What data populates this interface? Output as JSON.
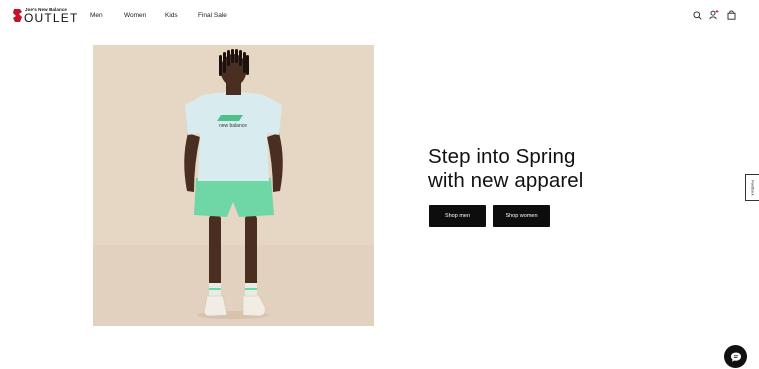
{
  "brand": {
    "top_line": "Joe's New Balance",
    "main_word": "OUTLET"
  },
  "nav": {
    "items": [
      {
        "label": "Men"
      },
      {
        "label": "Women"
      },
      {
        "label": "Kids"
      },
      {
        "label": "Final Sale"
      }
    ]
  },
  "header_icons": [
    "search-icon",
    "account-icon",
    "cart-icon"
  ],
  "hero": {
    "title_line1": "Step into Spring",
    "title_line2": "with new apparel",
    "shirt_text": "new balance",
    "buttons": {
      "shop_men": "Shop men",
      "shop_women": "Shop women"
    }
  },
  "side_tab": {
    "label": "Feedback"
  },
  "colors": {
    "accent_red": "#c8102e",
    "button_bg": "#0d0d0d",
    "hero_bg": "#e6d6c4",
    "shorts_green": "#6fd6a6"
  }
}
